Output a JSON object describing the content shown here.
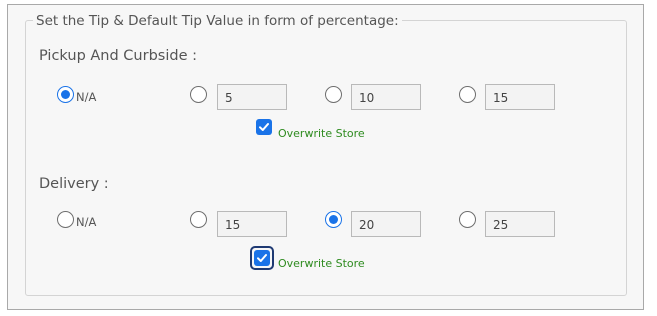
{
  "tip_settings": {
    "legend": "Set the Tip & Default Tip Value in form of percentage:"
  },
  "pickup": {
    "title": "Pickup And Curbside :",
    "options": [
      {
        "label": "N/A",
        "value": null,
        "selected": true
      },
      {
        "label": null,
        "value": "5",
        "selected": false
      },
      {
        "label": null,
        "value": "10",
        "selected": false
      },
      {
        "label": null,
        "value": "15",
        "selected": false
      }
    ],
    "overwrite_label": "Overwrite Store",
    "overwrite_checked": true
  },
  "delivery": {
    "title": "Delivery :",
    "options": [
      {
        "label": "N/A",
        "value": null,
        "selected": false
      },
      {
        "label": null,
        "value": "15",
        "selected": false
      },
      {
        "label": null,
        "value": "20",
        "selected": true
      },
      {
        "label": null,
        "value": "25",
        "selected": false
      }
    ],
    "overwrite_label": "Overwrite Store",
    "overwrite_checked": true
  },
  "colors": {
    "accent": "#1a73e8",
    "overwrite_text": "#2e8b1f",
    "panel_bg": "#f7f7f7"
  }
}
